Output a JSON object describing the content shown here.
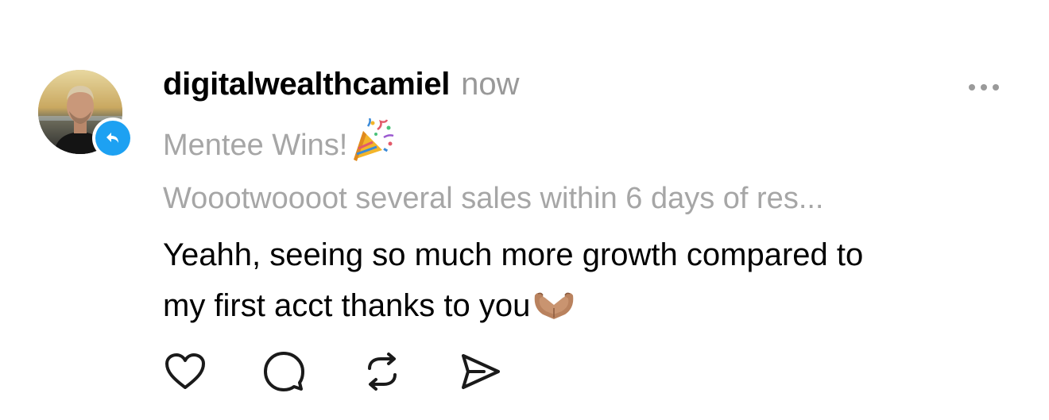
{
  "post": {
    "username": "digitalwealthcamiel",
    "timestamp": "now",
    "quoted": {
      "title": "Mentee Wins!",
      "title_icon": "party-popper-icon",
      "body": "Woootwoooot several sales within 6 days of res..."
    },
    "reply_lines": [
      "Yeahh, seeing so much more growth compared to",
      "my first acct thanks to you"
    ],
    "reply_icon": "heart-hands-icon"
  },
  "avatar": {
    "badge_icon": "repost-icon",
    "badge_color": "#1da1f2"
  },
  "actions": [
    {
      "icon": "heart-icon",
      "name": "like-button"
    },
    {
      "icon": "comment-icon",
      "name": "reply-button"
    },
    {
      "icon": "repost-icon",
      "name": "repost-button"
    },
    {
      "icon": "send-icon",
      "name": "share-button"
    }
  ],
  "colors": {
    "primary_text": "#000000",
    "secondary_text": "#999999",
    "quoted_text": "#a6a6a6",
    "icon_stroke": "#1a1a1a"
  }
}
